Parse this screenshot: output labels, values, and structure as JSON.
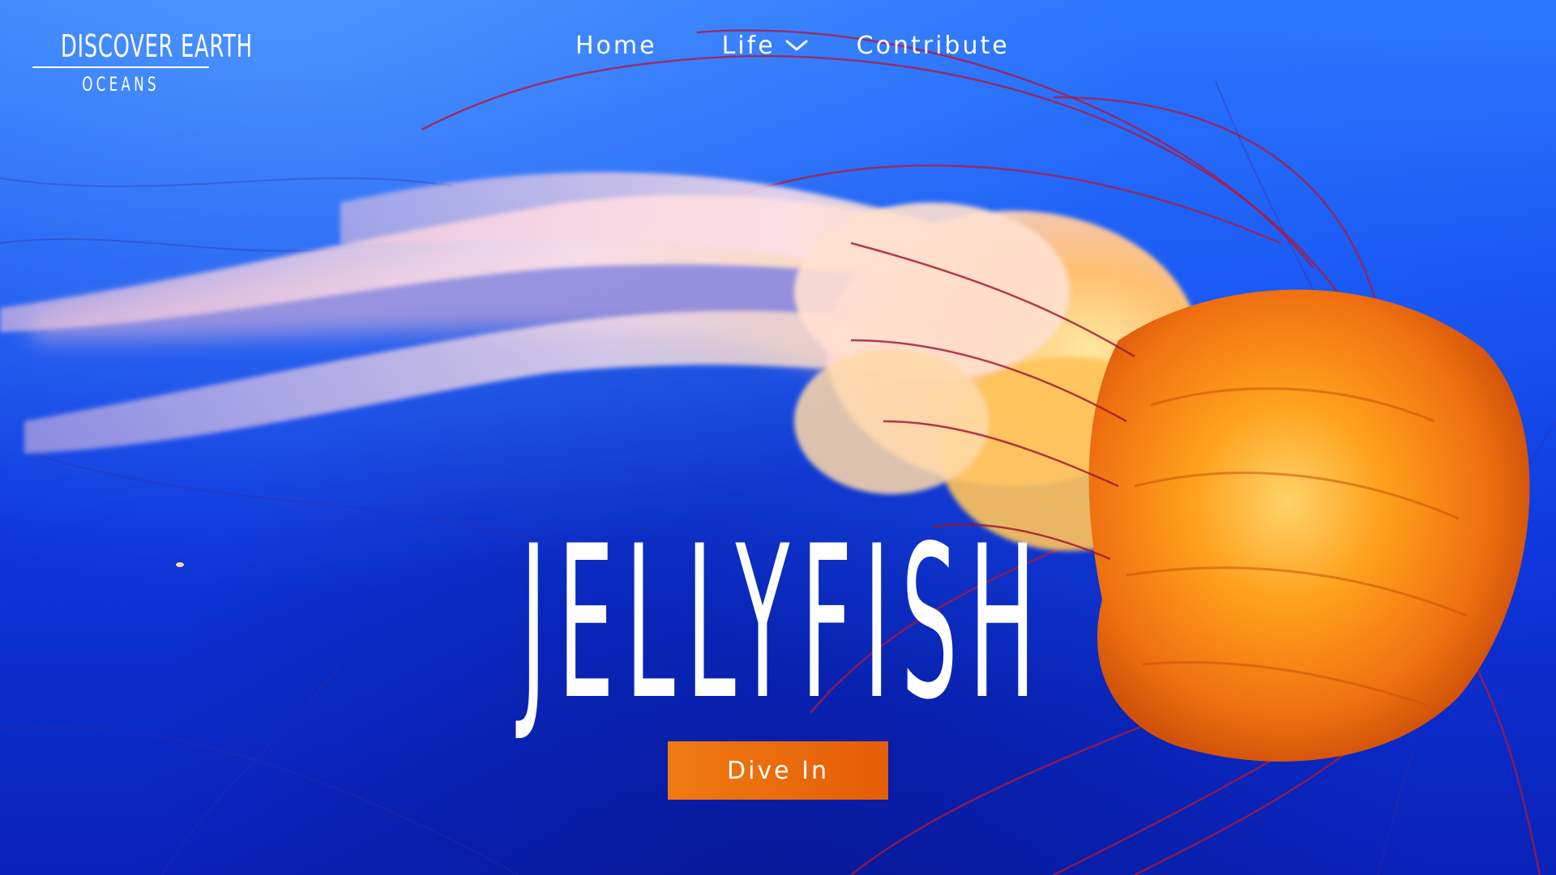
{
  "brand": {
    "title": "DISCOVER EARTH",
    "subtitle": "OCEANS"
  },
  "nav": {
    "items": [
      {
        "label": "Home"
      },
      {
        "label": "Life",
        "icon": "chevron-down-icon"
      },
      {
        "label": "Contribute"
      }
    ]
  },
  "hero": {
    "title": "JELLYFISH",
    "cta_label": "Dive In",
    "background_subject": "orange jellyfish in deep blue water"
  },
  "colors": {
    "water_top": "#2f7cff",
    "water_bottom": "#0a22b8",
    "button_orange": "#f07a12",
    "jelly_orange": "#f08a12",
    "tentacle_red": "#b0183a",
    "text": "#ffffff"
  }
}
